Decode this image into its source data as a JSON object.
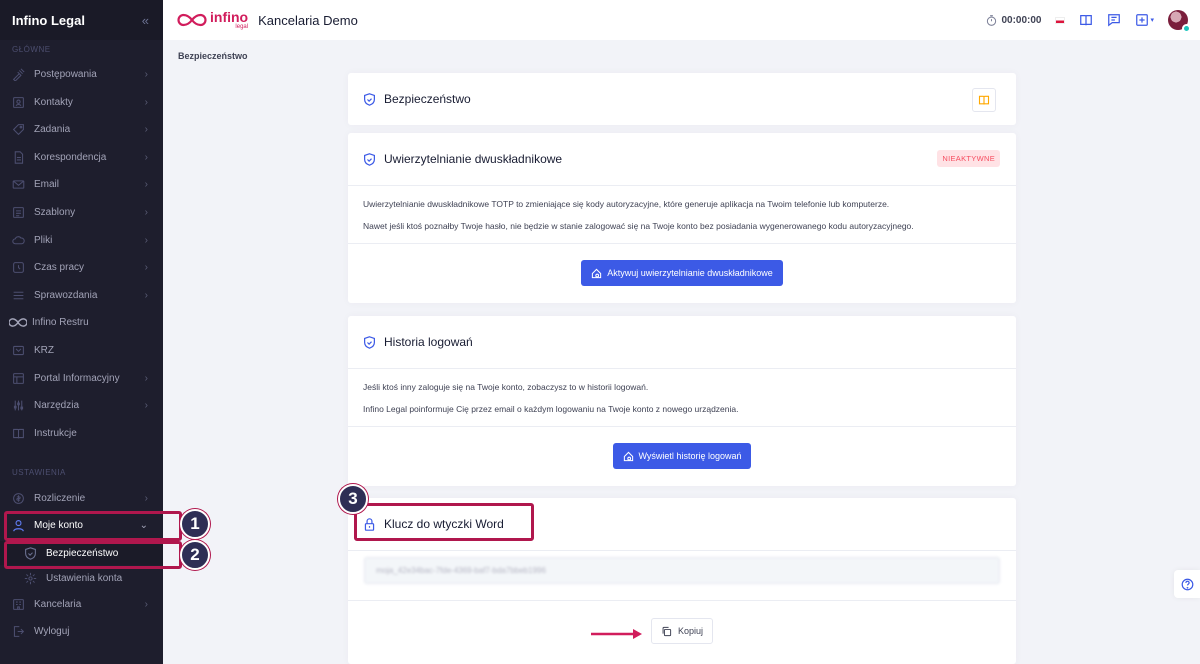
{
  "sidebar": {
    "brand": "Infino Legal",
    "section_main": "GŁÓWNE",
    "section_settings": "USTAWIENIA",
    "items": [
      {
        "label": "Postępowania"
      },
      {
        "label": "Kontakty"
      },
      {
        "label": "Zadania"
      },
      {
        "label": "Korespondencja"
      },
      {
        "label": "Email"
      },
      {
        "label": "Szablony"
      },
      {
        "label": "Pliki"
      },
      {
        "label": "Czas pracy"
      },
      {
        "label": "Sprawozdania"
      },
      {
        "label": "Infino Restru"
      },
      {
        "label": "KRZ"
      },
      {
        "label": "Portal Informacyjny"
      },
      {
        "label": "Narzędzia"
      },
      {
        "label": "Instrukcje"
      }
    ],
    "settings_items": [
      {
        "label": "Rozliczenie"
      },
      {
        "label": "Moje konto"
      },
      {
        "label": "Bezpieczeństwo"
      },
      {
        "label": "Ustawienia konta"
      },
      {
        "label": "Kancelaria"
      },
      {
        "label": "Wyloguj"
      }
    ]
  },
  "topbar": {
    "logo_word": "infino",
    "logo_sub": "legal",
    "company": "Kancelaria Demo",
    "timer": "00:00:00"
  },
  "breadcrumb": "Bezpieczeństwo",
  "cards": {
    "security": {
      "title": "Bezpieczeństwo"
    },
    "twofa": {
      "title": "Uwierzytelnianie dwuskładnikowe",
      "badge": "NIEAKTYWNE",
      "p1": "Uwierzytelnianie dwuskładnikowe TOTP to zmieniające się kody autoryzacyjne, które generuje aplikacja na Twoim telefonie lub komputerze.",
      "p2": "Nawet jeśli ktoś poznałby Twoje hasło, nie będzie w stanie zalogować się na Twoje konto bez posiadania wygenerowanego kodu autoryzacyjnego.",
      "button": "Aktywuj uwierzytelnianie dwuskładnikowe"
    },
    "history": {
      "title": "Historia logowań",
      "p1": "Jeśli ktoś inny zaloguje się na Twoje konto, zobaczysz to w historii logowań.",
      "p2": "Infino Legal poinformuje Cię przez email o każdym logowaniu na Twoje konto z nowego urządzenia.",
      "button": "Wyświetl historię logowań"
    },
    "word": {
      "title": "Klucz do wtyczki Word",
      "key": "moja_42e34bac-7fde-4369-baf7-bda7bbeb1996",
      "button": "Kopiuj"
    }
  },
  "annotations": [
    "1",
    "2",
    "3"
  ],
  "colors": {
    "accent": "#3c5ae6",
    "annotation": "#b0174d",
    "sidebar": "#1e1e2d"
  }
}
